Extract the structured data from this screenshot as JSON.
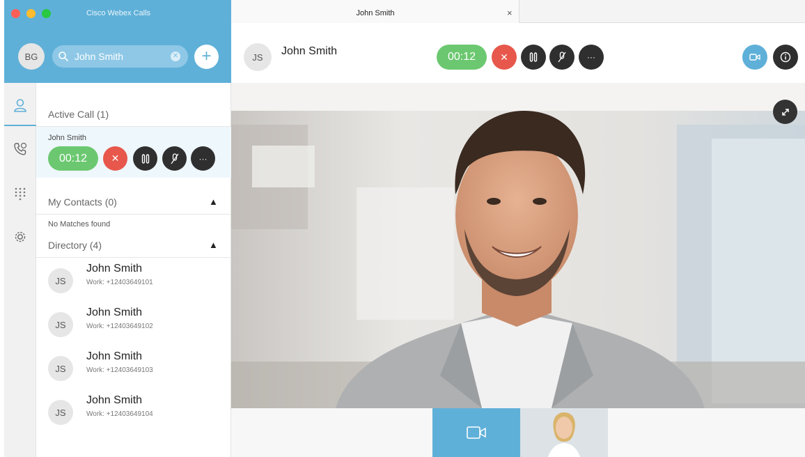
{
  "app": {
    "title": "Cisco Webex Calls",
    "user_initials": "BG",
    "traffic_colors": [
      "#fd5f57",
      "#febc2e",
      "#28c840"
    ]
  },
  "search": {
    "value": "John Smith",
    "clear_icon": "clear-icon",
    "add_icon": "plus-icon"
  },
  "nav": {
    "items": [
      {
        "icon": "contacts-icon",
        "active": true
      },
      {
        "icon": "call-history-icon",
        "active": false
      },
      {
        "icon": "dialpad-icon",
        "active": false
      },
      {
        "icon": "settings-gear-icon",
        "active": false
      }
    ]
  },
  "active_call": {
    "header": "Active Call (1)",
    "caller": "John Smith",
    "timer": "00:12"
  },
  "my_contacts": {
    "header": "My Contacts (0)",
    "empty_text": "No Matches found"
  },
  "directory": {
    "header": "Directory (4)",
    "contacts": [
      {
        "initials": "JS",
        "name": "John Smith",
        "sub": "Work: +12403649101"
      },
      {
        "initials": "JS",
        "name": "John Smith",
        "sub": "Work: +12403649102"
      },
      {
        "initials": "JS",
        "name": "John Smith",
        "sub": "Work: +12403649103"
      },
      {
        "initials": "JS",
        "name": "John Smith",
        "sub": "Work: +12403649104"
      }
    ]
  },
  "tab": {
    "title": "John Smith",
    "close": "×"
  },
  "call_header": {
    "initials": "JS",
    "name": "John Smith",
    "timer": "00:12"
  },
  "colors": {
    "accent": "#5fb0d8",
    "green": "#6cc870",
    "red": "#e8574b",
    "dark": "#2f2f2f"
  }
}
